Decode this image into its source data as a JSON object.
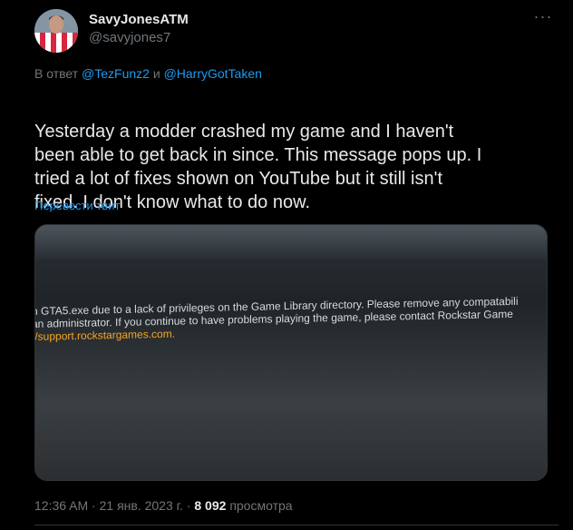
{
  "author": {
    "display_name": "SavyJonesATM",
    "handle": "@savyjones7"
  },
  "reply": {
    "prefix": "В ответ",
    "user1": "@TezFunz2",
    "conjunction": "и",
    "user2": "@HarryGotTaken"
  },
  "tweet": {
    "text": "Yesterday a modder crashed my game and I haven't\nbeen able to get back in since. This message pops up. I\ntried a lot of fixes shown on YouTube but it still isn't\nfixed. I don't know what to do now.",
    "translate_label": "Перевести твит"
  },
  "media": {
    "line1": "n GTA5.exe due to a lack of privileges on the Game Library directory. Please remove any compatabili",
    "line2": " an administrator. If you continue to have problems playing the game, please contact Rockstar Game",
    "line3": "//support.rockstargames.com."
  },
  "meta": {
    "time": "12:36 AM",
    "separator": "·",
    "date": "21 янв. 2023 г.",
    "views_count": "8 092",
    "views_label": "просмотра"
  },
  "more_icon": "more-horizontal-icon",
  "colors": {
    "background": "#000000",
    "text": "#e7e9ea",
    "secondary": "#71767b",
    "link": "#1d9bf0",
    "media_link": "#f5a623"
  }
}
